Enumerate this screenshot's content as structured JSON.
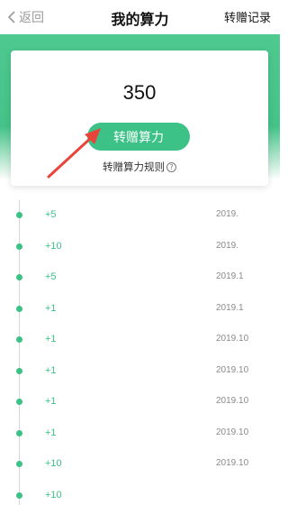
{
  "nav": {
    "back_label": "返回",
    "title": "我的算力",
    "right_label": "转赠记录"
  },
  "card": {
    "balance": "350",
    "transfer_button": "转赠算力",
    "rules_label": "转赠算力规则",
    "rules_icon": "question-circle-icon"
  },
  "records": [
    {
      "amount": "+5",
      "date": "2019."
    },
    {
      "amount": "+10",
      "date": "2019."
    },
    {
      "amount": "+5",
      "date": "2019.1"
    },
    {
      "amount": "+1",
      "date": "2019.1"
    },
    {
      "amount": "+1",
      "date": "2019.10"
    },
    {
      "amount": "+1",
      "date": "2019.10"
    },
    {
      "amount": "+1",
      "date": "2019.10"
    },
    {
      "amount": "+1",
      "date": "2019.10"
    },
    {
      "amount": "+10",
      "date": "2019.10"
    },
    {
      "amount": "+10",
      "date": ""
    }
  ],
  "colors": {
    "accent": "#3cc187",
    "annotation_arrow": "#e8443a"
  }
}
